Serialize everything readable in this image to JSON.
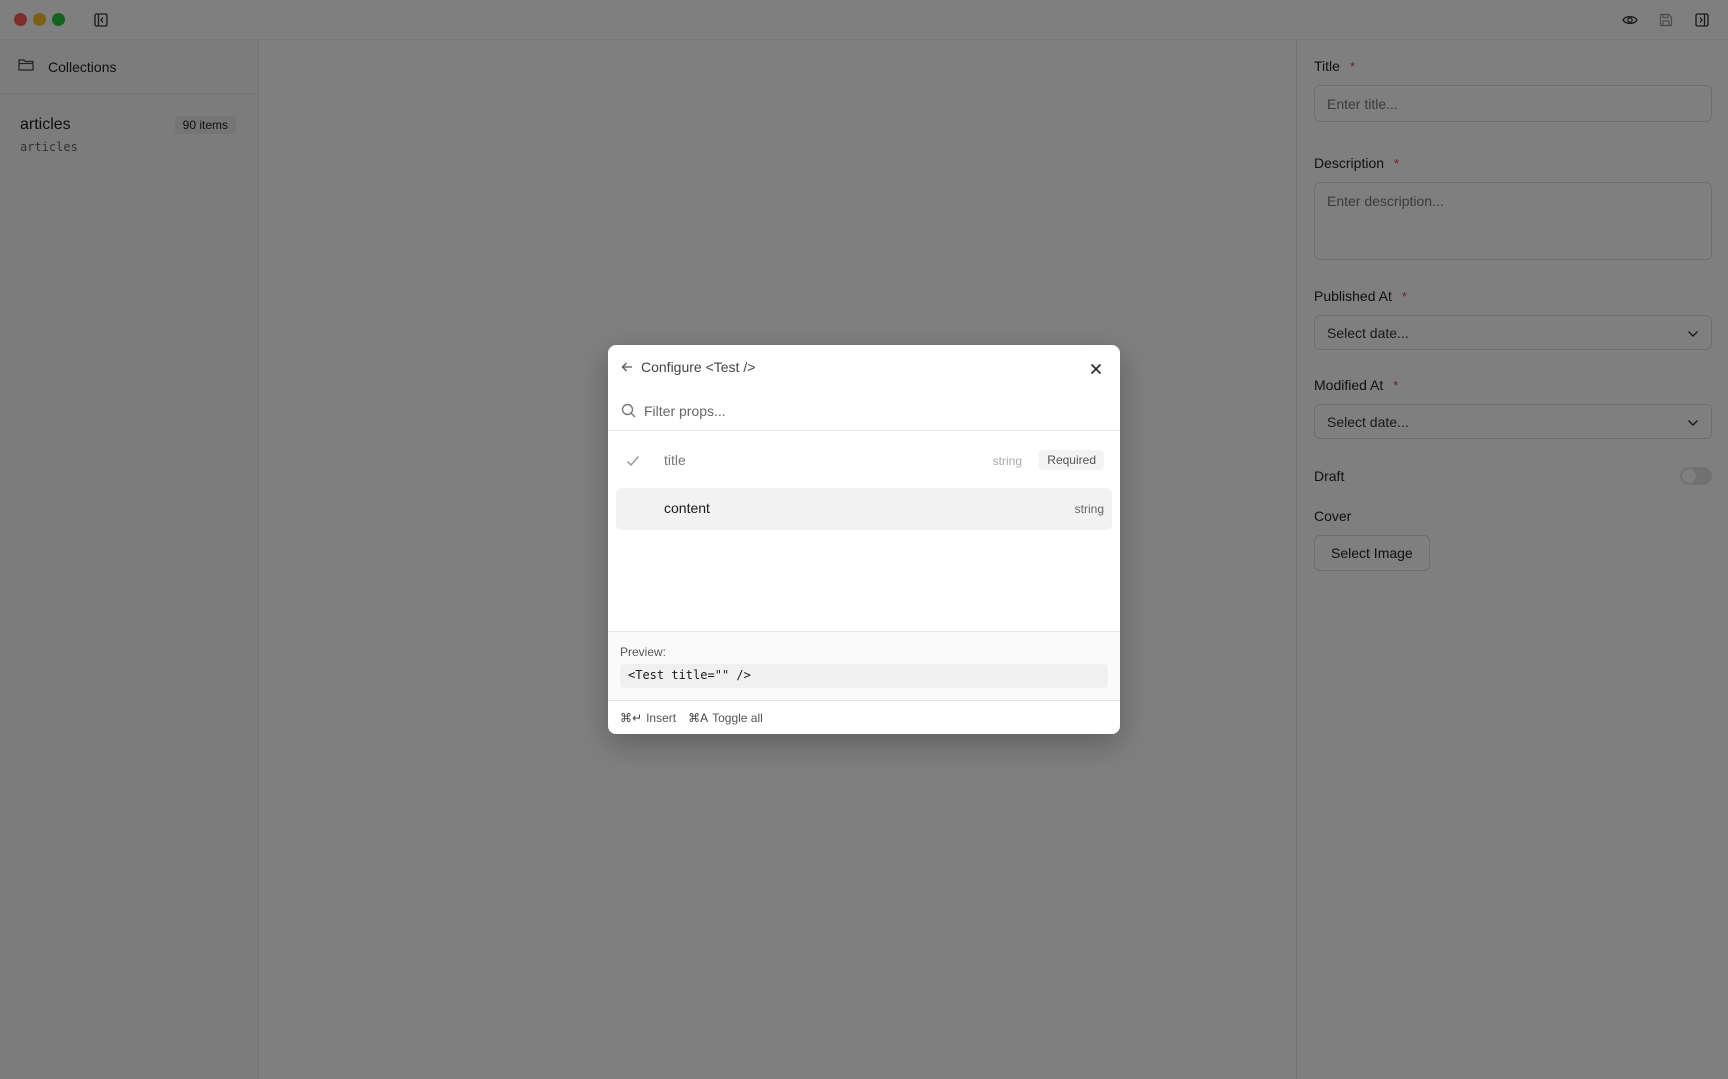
{
  "titlebar": {
    "icons": [
      "sidebar-toggle-icon",
      "preview-eye-icon",
      "save-icon",
      "panel-toggle-icon"
    ]
  },
  "sidebar": {
    "header_label": "Collections",
    "collections": [
      {
        "name": "articles",
        "slug": "articles",
        "count": "90 items"
      }
    ]
  },
  "panel": {
    "title_label": "Title",
    "title_placeholder": "Enter title...",
    "description_label": "Description",
    "description_placeholder": "Enter description...",
    "published_label": "Published At",
    "published_value": "Select date...",
    "modified_label": "Modified At",
    "modified_value": "Select date...",
    "draft_label": "Draft",
    "draft_enabled": false,
    "cover_label": "Cover",
    "cover_button": "Select Image",
    "required_mark": "*"
  },
  "dialog": {
    "title": "Configure <Test />",
    "search_placeholder": "Filter props...",
    "props": [
      {
        "name": "title",
        "type": "string",
        "badge": "Required",
        "checked": true
      },
      {
        "name": "content",
        "type": "string",
        "badge": "",
        "checked": false
      }
    ],
    "preview_label": "Preview:",
    "preview_code": "<Test title=\"\" />",
    "footer": {
      "insert_key": "⌘↵",
      "insert_label": "Insert",
      "toggle_key": "⌘A",
      "toggle_label": "Toggle all"
    }
  },
  "colors": {
    "overlay": "rgba(0,0,0,0.5)",
    "required": "#e5484d",
    "traffic_red": "#ff5f57",
    "traffic_yellow": "#febc2e",
    "traffic_green": "#28c840"
  }
}
